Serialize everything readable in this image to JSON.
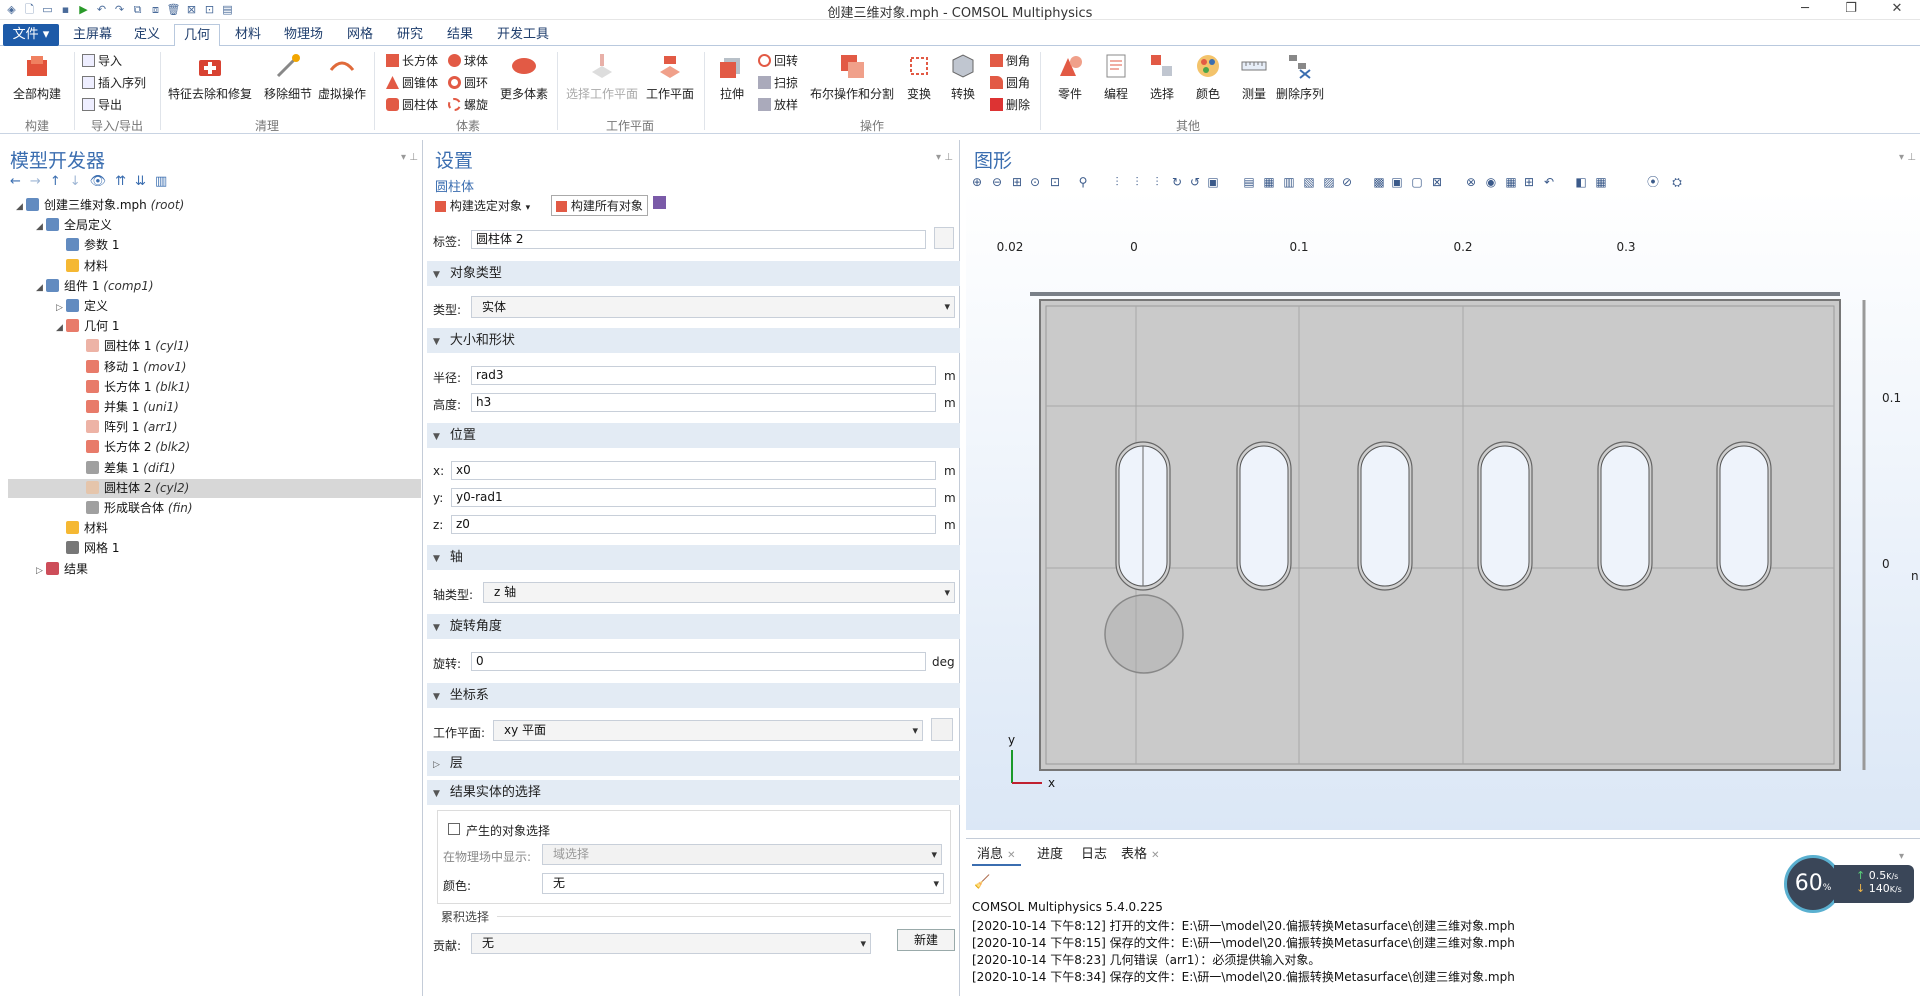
{
  "window": {
    "title": "创建三维对象.mph - COMSOL Multiphysics"
  },
  "menu": {
    "file": "文件 ▾",
    "tabs": [
      "主屏幕",
      "定义",
      "几何",
      "材料",
      "物理场",
      "网格",
      "研究",
      "结果",
      "开发工具"
    ],
    "active": "几何"
  },
  "ribbon": {
    "build_all": "全部构建",
    "import": "导入",
    "insert_sequence": "插入序列",
    "export": "导出",
    "group_build": "构建",
    "group_io": "导入/导出",
    "defeature": "特征去除和修复",
    "remove_details": "移除细节",
    "virtual_ops": "虚拟操作",
    "group_cleanup": "清理",
    "block": "长方体",
    "cone": "圆锥体",
    "cylinder": "圆柱体",
    "sphere": "球体",
    "torus": "圆环",
    "helix": "螺旋",
    "more_primitives": "更多体素",
    "group_primitives": "体素",
    "select_wp": "选择工作平面",
    "work_plane": "工作平面",
    "group_wp": "工作平面",
    "extrude": "拉伸",
    "revolve": "回转",
    "sweep": "扫掠",
    "loft": "放样",
    "booleans": "布尔操作和分割",
    "transforms": "变换",
    "conversions": "转换",
    "chamfer": "倒角",
    "fillet": "圆角",
    "delete": "删除",
    "group_ops": "操作",
    "parts": "零件",
    "programming": "编程",
    "selections": "选择",
    "colors": "颜色",
    "measure": "测量",
    "delete_sequence": "删除序列",
    "group_other": "其他"
  },
  "model_builder": {
    "title": "模型开发器",
    "tree": [
      {
        "label": "创建三维对象.mph",
        "tag": "(root)",
        "level": 0,
        "toggle": "◢",
        "icon": "root"
      },
      {
        "label": "全局定义",
        "tag": "",
        "level": 1,
        "toggle": "◢",
        "icon": "globe"
      },
      {
        "label": "参数 1",
        "tag": "",
        "level": 2,
        "toggle": "",
        "icon": "param"
      },
      {
        "label": "材料",
        "tag": "",
        "level": 2,
        "toggle": "",
        "icon": "mat"
      },
      {
        "label": "组件 1",
        "tag": "(comp1)",
        "level": 1,
        "toggle": "◢",
        "icon": "comp"
      },
      {
        "label": "定义",
        "tag": "",
        "level": 2,
        "toggle": "▷",
        "icon": "def"
      },
      {
        "label": "几何 1",
        "tag": "",
        "level": 2,
        "toggle": "◢",
        "icon": "geom"
      },
      {
        "label": "圆柱体 1",
        "tag": "(cyl1)",
        "level": 3,
        "toggle": "",
        "icon": "cyl"
      },
      {
        "label": "移动 1",
        "tag": "(mov1)",
        "level": 3,
        "toggle": "",
        "icon": "move"
      },
      {
        "label": "长方体 1",
        "tag": "(blk1)",
        "level": 3,
        "toggle": "",
        "icon": "blk"
      },
      {
        "label": "并集 1",
        "tag": "(uni1)",
        "level": 3,
        "toggle": "",
        "icon": "uni"
      },
      {
        "label": "阵列 1",
        "tag": "(arr1)",
        "level": 3,
        "toggle": "",
        "icon": "arr"
      },
      {
        "label": "长方体 2",
        "tag": "(blk2)",
        "level": 3,
        "toggle": "",
        "icon": "blk"
      },
      {
        "label": "差集 1",
        "tag": "(dif1)",
        "level": 3,
        "toggle": "",
        "icon": "dif"
      },
      {
        "label": "圆柱体 2",
        "tag": "(cyl2)",
        "level": 3,
        "toggle": "",
        "icon": "cyl2",
        "selected": true
      },
      {
        "label": "形成联合体",
        "tag": "(fin)",
        "level": 3,
        "toggle": "",
        "icon": "fin"
      },
      {
        "label": "材料",
        "tag": "",
        "level": 2,
        "toggle": "",
        "icon": "mat"
      },
      {
        "label": "网格 1",
        "tag": "",
        "level": 2,
        "toggle": "",
        "icon": "mesh"
      },
      {
        "label": "结果",
        "tag": "",
        "level": 1,
        "toggle": "▷",
        "icon": "res"
      }
    ]
  },
  "settings": {
    "title": "设置",
    "subtitle": "圆柱体",
    "build_selected": "构建选定对象",
    "build_all": "构建所有对象",
    "label_label": "标签:",
    "label_value": "圆柱体 2",
    "sec_object_type": "对象类型",
    "type_label": "类型:",
    "type_value": "实体",
    "sec_size": "大小和形状",
    "radius_label": "半径:",
    "radius_value": "rad3",
    "height_label": "高度:",
    "height_value": "h3",
    "unit_m": "m",
    "sec_position": "位置",
    "x_label": "x:",
    "x_value": "x0",
    "y_label": "y:",
    "y_value": "y0-rad1",
    "z_label": "z:",
    "z_value": "z0",
    "sec_axis": "轴",
    "axis_type_label": "轴类型:",
    "axis_type_value": "z 轴",
    "sec_rotation": "旋转角度",
    "rotation_label": "旋转:",
    "rotation_value": "0",
    "unit_deg": "deg",
    "sec_coord": "坐标系",
    "wp_label": "工作平面:",
    "wp_value": "xy 平面",
    "sec_layers": "层",
    "sec_selections": "结果实体的选择",
    "resulting_sel": "产生的对象选择",
    "show_in_physics_label": "在物理场中显示:",
    "show_in_physics_value": "域选择",
    "color_label": "颜色:",
    "color_value": "无",
    "cumulative": "累积选择",
    "contribute_label": "贡献:",
    "contribute_value": "无",
    "new_button": "新建"
  },
  "graphics": {
    "title": "图形",
    "x_ticks": [
      "0.02",
      "0",
      "0.1",
      "0.2",
      "0.3"
    ],
    "y_ticks": [
      "0.1",
      "0"
    ],
    "axis_x": "x",
    "axis_y": "y",
    "edge_label": "n"
  },
  "messages": {
    "tabs": [
      "消息",
      "进度",
      "日志",
      "表格"
    ],
    "lines": [
      "COMSOL Multiphysics 5.4.0.225",
      "[2020-10-14 下午8:12] 打开的文件：E:\\研一\\model\\20.偏振转换Metasurface\\创建三维对象.mph",
      "[2020-10-14 下午8:15] 保存的文件：E:\\研一\\model\\20.偏振转换Metasurface\\创建三维对象.mph",
      "[2020-10-14 下午8:23] 几何错误（arr1）：必须提供输入对象。",
      "[2020-10-14 下午8:34] 保存的文件：E:\\研一\\model\\20.偏振转换Metasurface\\创建三维对象.mph"
    ]
  },
  "speed": {
    "percent": "60",
    "unit": "%",
    "up": "0.5",
    "up_unit": "K/s",
    "down": "140",
    "down_unit": "K/s"
  },
  "colors": {
    "accent": "#3b6eb0",
    "file_tab": "#1d5aa8",
    "section": "#e3ebf4",
    "graphics_bg": "#dfe8f5",
    "geometry": "#c9c9c9"
  }
}
